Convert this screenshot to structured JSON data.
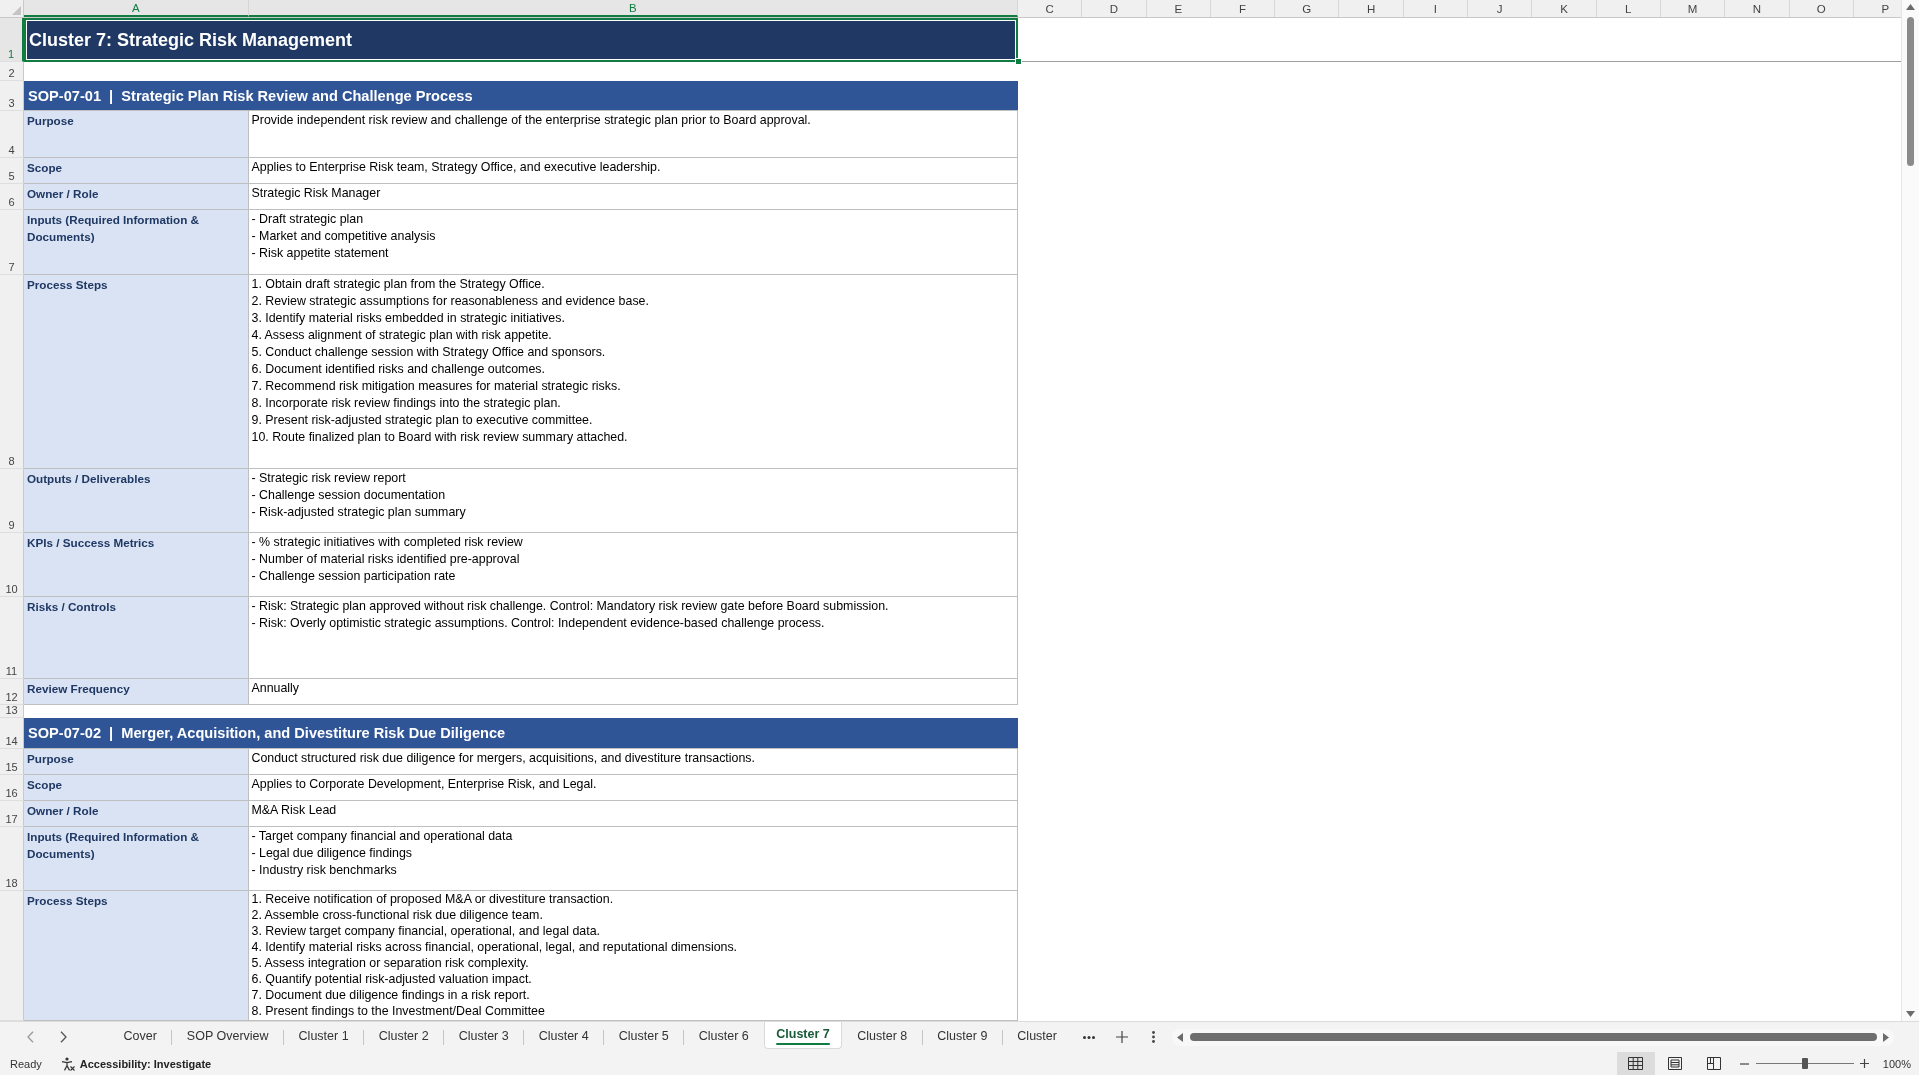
{
  "sheet": {
    "columns": [
      {
        "label": "A",
        "selected": true
      },
      {
        "label": "B",
        "selected": true
      },
      {
        "label": "C",
        "selected": false
      },
      {
        "label": "D",
        "selected": false
      },
      {
        "label": "E",
        "selected": false
      },
      {
        "label": "F",
        "selected": false
      },
      {
        "label": "G",
        "selected": false
      },
      {
        "label": "H",
        "selected": false
      },
      {
        "label": "I",
        "selected": false
      },
      {
        "label": "J",
        "selected": false
      },
      {
        "label": "K",
        "selected": false
      },
      {
        "label": "L",
        "selected": false
      },
      {
        "label": "M",
        "selected": false
      },
      {
        "label": "N",
        "selected": false
      },
      {
        "label": "O",
        "selected": false
      },
      {
        "label": "P",
        "selected": false
      }
    ],
    "rows": [
      {
        "number": "1",
        "selected": true,
        "kind": "title",
        "text": "Cluster 7: Strategic Risk Management"
      },
      {
        "number": "2",
        "selected": false,
        "kind": "blank"
      },
      {
        "number": "3",
        "selected": false,
        "kind": "section",
        "text": "SOP-07-01  |  Strategic Plan Risk Review and Challenge Process"
      },
      {
        "number": "4",
        "selected": false,
        "kind": "field",
        "label": "Purpose",
        "lines": [
          "Provide independent risk review and challenge of the enterprise strategic plan prior to Board approval."
        ]
      },
      {
        "number": "5",
        "selected": false,
        "kind": "field",
        "label": "Scope",
        "lines": [
          "Applies to Enterprise Risk team, Strategy Office, and executive leadership."
        ]
      },
      {
        "number": "6",
        "selected": false,
        "kind": "field",
        "label": "Owner / Role",
        "lines": [
          "Strategic Risk Manager"
        ]
      },
      {
        "number": "7",
        "selected": false,
        "kind": "field",
        "label": "Inputs (Required Information & Documents)",
        "lines": [
          "- Draft strategic plan",
          "- Market and competitive analysis",
          "- Risk appetite statement"
        ]
      },
      {
        "number": "8",
        "selected": false,
        "kind": "field",
        "label": "Process Steps",
        "lines": [
          "1. Obtain draft strategic plan from the Strategy Office.",
          "2. Review strategic assumptions for reasonableness and evidence base.",
          "3. Identify material risks embedded in strategic initiatives.",
          "4. Assess alignment of strategic plan with risk appetite.",
          "5. Conduct challenge session with Strategy Office and sponsors.",
          "6. Document identified risks and challenge outcomes.",
          "7. Recommend risk mitigation measures for material strategic risks.",
          "8. Incorporate risk review findings into the strategic plan.",
          "9. Present risk-adjusted strategic plan to executive committee.",
          "10. Route finalized plan to Board with risk review summary attached."
        ]
      },
      {
        "number": "9",
        "selected": false,
        "kind": "field",
        "label": "Outputs / Deliverables",
        "lines": [
          "- Strategic risk review report",
          "- Challenge session documentation",
          "- Risk-adjusted strategic plan summary"
        ]
      },
      {
        "number": "10",
        "selected": false,
        "kind": "field",
        "label": "KPIs / Success Metrics",
        "lines": [
          "- % strategic initiatives with completed risk review",
          "- Number of material risks identified pre-approval",
          "- Challenge session participation rate"
        ]
      },
      {
        "number": "11",
        "selected": false,
        "kind": "field",
        "label": "Risks / Controls",
        "lines": [
          "- Risk: Strategic plan approved without risk challenge. Control: Mandatory risk review gate before Board submission.",
          "- Risk: Overly optimistic strategic assumptions. Control: Independent evidence-based challenge process."
        ]
      },
      {
        "number": "12",
        "selected": false,
        "kind": "field",
        "label": "Review Frequency",
        "lines": [
          "Annually"
        ]
      },
      {
        "number": "13",
        "selected": false,
        "kind": "blank"
      },
      {
        "number": "14",
        "selected": false,
        "kind": "section",
        "text": "SOP-07-02  |  Merger, Acquisition, and Divestiture Risk Due Diligence"
      },
      {
        "number": "15",
        "selected": false,
        "kind": "field",
        "label": "Purpose",
        "lines": [
          "Conduct structured risk due diligence for mergers, acquisitions, and divestiture transactions."
        ]
      },
      {
        "number": "16",
        "selected": false,
        "kind": "field",
        "label": "Scope",
        "lines": [
          "Applies to Corporate Development, Enterprise Risk, and Legal."
        ]
      },
      {
        "number": "17",
        "selected": false,
        "kind": "field",
        "label": "Owner / Role",
        "lines": [
          "M&A Risk Lead"
        ]
      },
      {
        "number": "18",
        "selected": false,
        "kind": "field",
        "label": "Inputs (Required Information & Documents)",
        "lines": [
          "- Target company financial and operational data",
          "- Legal due diligence findings",
          "- Industry risk benchmarks"
        ]
      },
      {
        "selected": false,
        "kind": "field",
        "label": "Process Steps",
        "lines": [
          "1. Receive notification of proposed M&A or divestiture transaction.",
          "2. Assemble cross-functional risk due diligence team.",
          "3. Review target company financial, operational, and legal data.",
          "4. Identify material risks across financial, operational, legal, and reputational dimensions.",
          "5. Assess integration or separation risk complexity.",
          "6. Quantify potential risk-adjusted valuation impact.",
          "7. Document due diligence findings in a risk report.",
          "8. Present findings to the Investment/Deal Committee"
        ]
      }
    ]
  },
  "sheet_tabs": {
    "tabs": [
      {
        "label": "Cover",
        "selected": false
      },
      {
        "label": "SOP Overview",
        "selected": false
      },
      {
        "label": "Cluster 1",
        "selected": false
      },
      {
        "label": "Cluster 2",
        "selected": false
      },
      {
        "label": "Cluster 3",
        "selected": false
      },
      {
        "label": "Cluster 4",
        "selected": false
      },
      {
        "label": "Cluster 5",
        "selected": false
      },
      {
        "label": "Cluster 6",
        "selected": false
      },
      {
        "label": "Cluster 7",
        "selected": true
      },
      {
        "label": "Cluster 8",
        "selected": false
      },
      {
        "label": "Cluster 9",
        "selected": false
      },
      {
        "label": "Cluster",
        "selected": false
      }
    ]
  },
  "status_bar": {
    "status": "Ready",
    "accessibility": "Accessibility: Investigate",
    "views": [
      {
        "kind": "normal",
        "selected": true
      },
      {
        "kind": "page_layout",
        "selected": false
      },
      {
        "kind": "page_break",
        "selected": false
      }
    ],
    "zoom": {
      "level": 0.5,
      "reading": "100%"
    }
  }
}
